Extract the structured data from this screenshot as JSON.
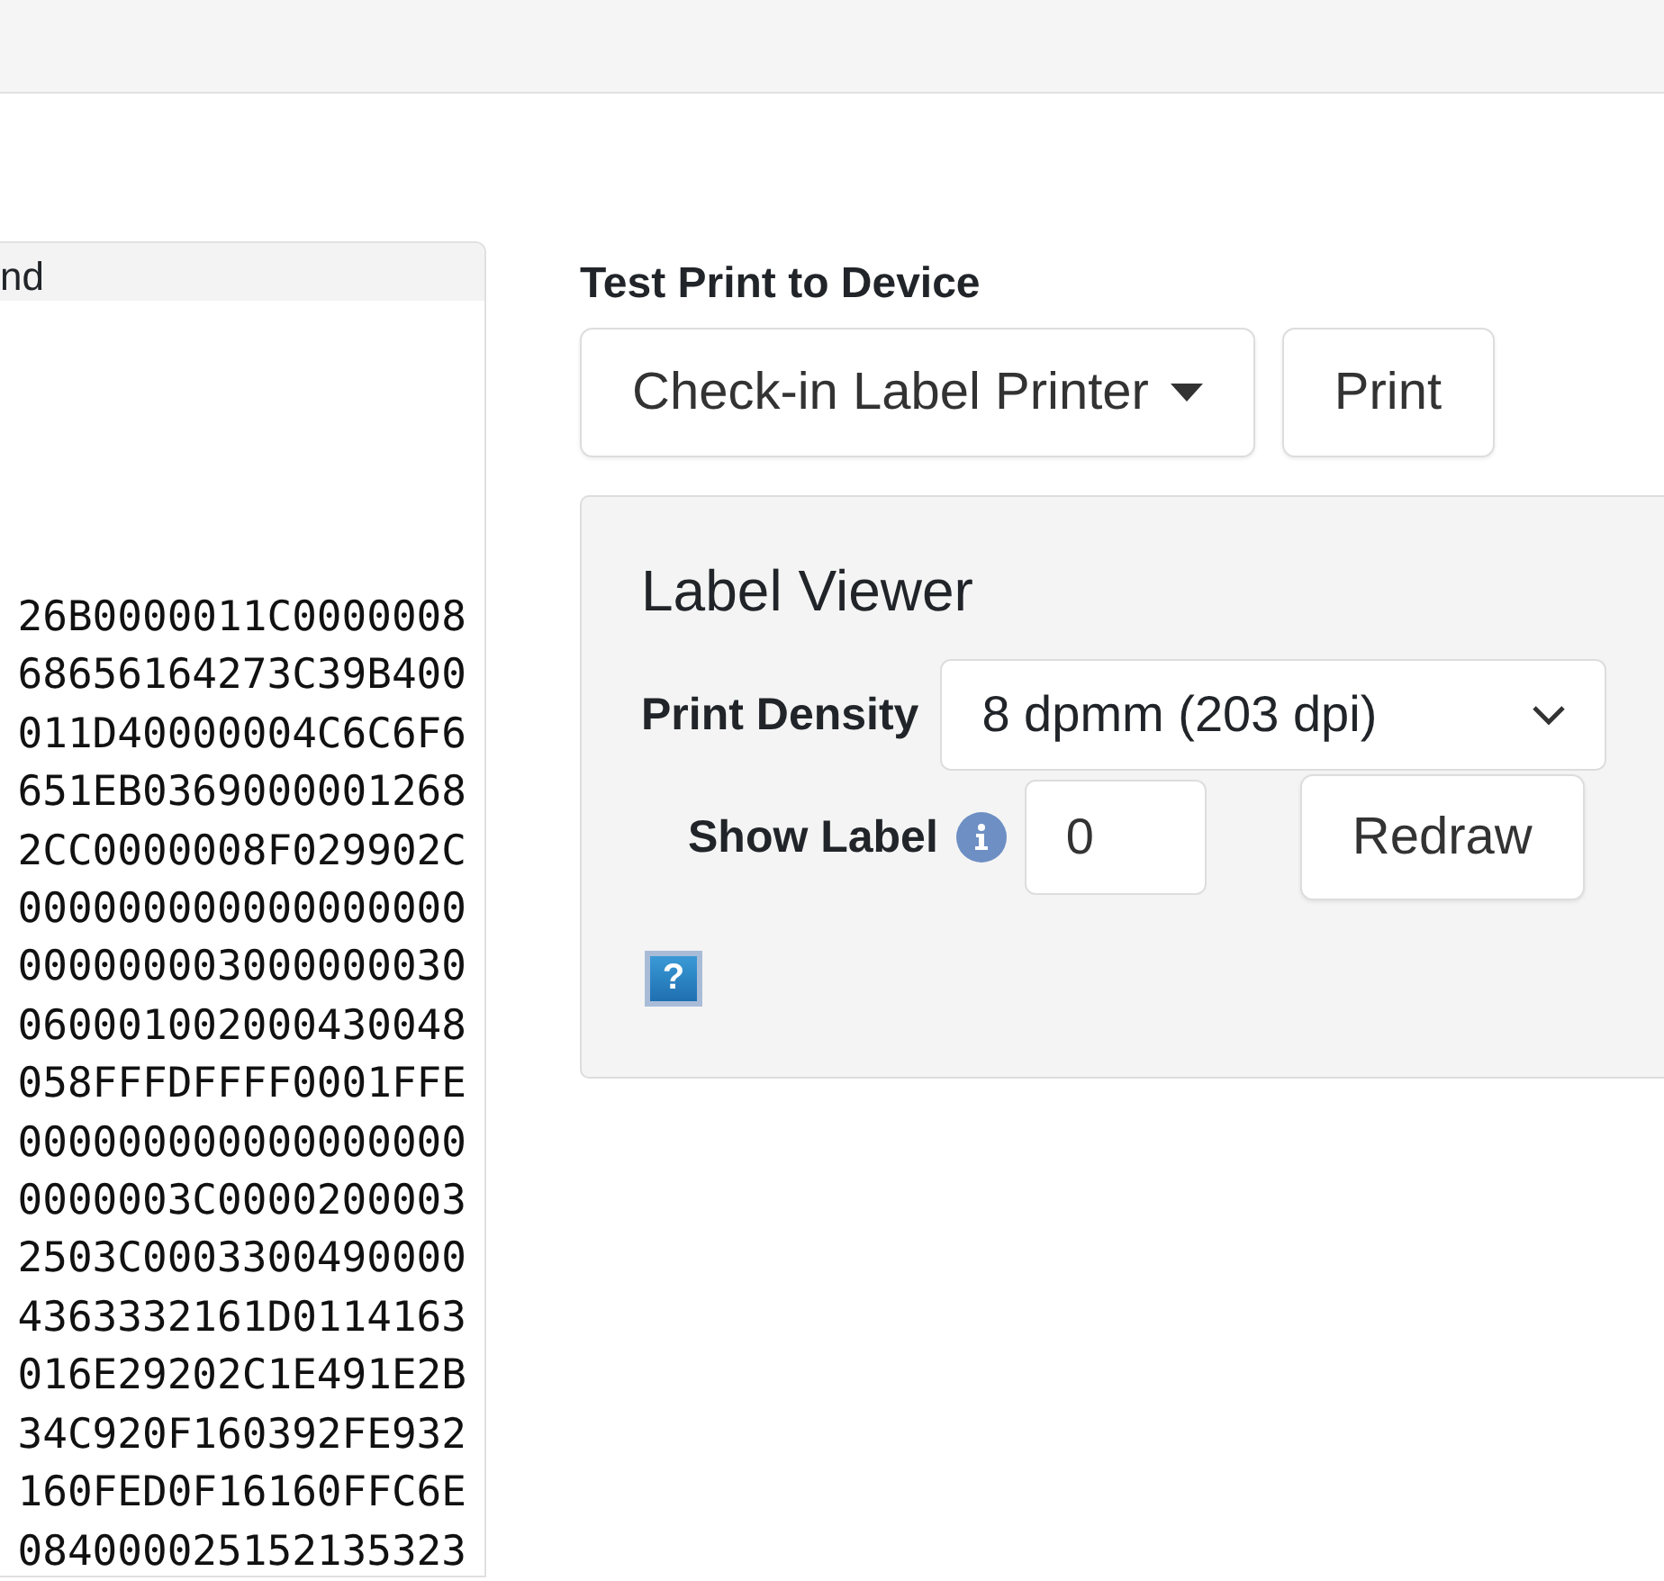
{
  "left_panel": {
    "header": "nd",
    "lines": [
      "26B0000011C0000008",
      "68656164273C39B400",
      "011D40000004C6C6F6",
      "651EB0369000001268",
      "2CC0000008F029902C",
      "000000000000000000",
      "000000003000000030",
      "060001002000430048",
      "058FFFDFFFF0001FFE",
      "000000000000000000",
      "0000003C0000200003",
      "2503C0003300490000",
      "4363332161D0114163",
      "016E29202C1E491E2B",
      "34C920F160392FE932",
      "160FED0F16160FFC6E",
      "084000025152135323"
    ]
  },
  "test_print": {
    "title": "Test Print to Device",
    "printer": "Check-in Label Printer",
    "print_button": "Print"
  },
  "label_viewer": {
    "title": "Label Viewer",
    "density_label": "Print Density",
    "density_value": "8 dpmm (203 dpi)",
    "show_label": "Show Label",
    "show_label_value": "0",
    "redraw_button": "Redraw",
    "help_icon": "?"
  }
}
